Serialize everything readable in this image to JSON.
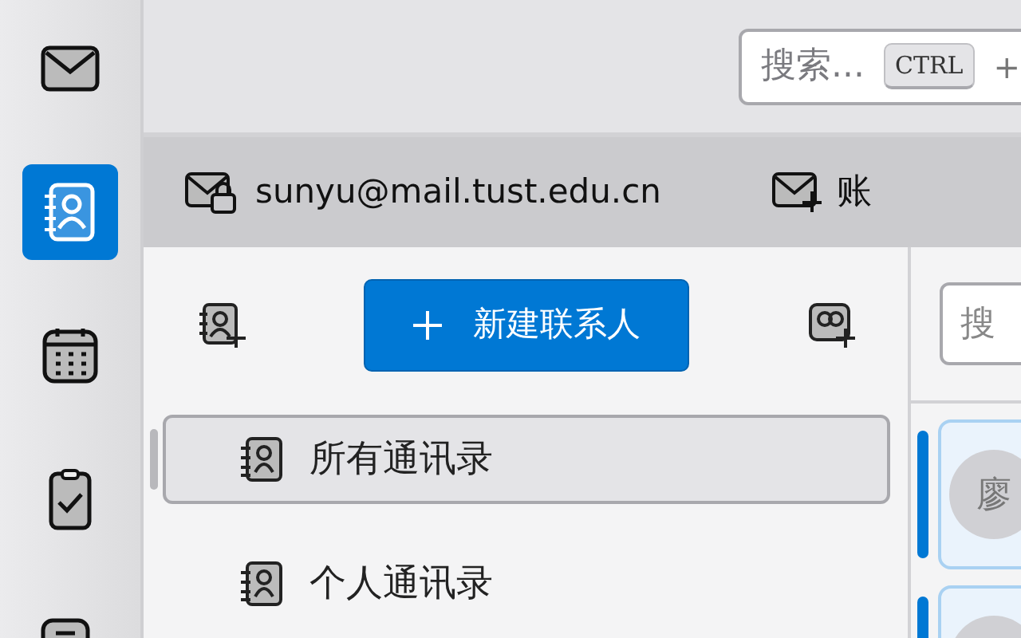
{
  "rail": [
    {
      "kind": "mail",
      "selected": false
    },
    {
      "kind": "contacts",
      "selected": true
    },
    {
      "kind": "calendar",
      "selected": false
    },
    {
      "kind": "tasks",
      "selected": false
    },
    {
      "kind": "chat",
      "selected": false
    }
  ],
  "search": {
    "placeholder": "搜索...",
    "key": "CTRL",
    "plus": "+"
  },
  "account_bar": {
    "address": "sunyu@mail.tust.edu.cn",
    "new_account": "账"
  },
  "toolbar": {
    "new_contact": "新建联系人"
  },
  "address_books": [
    {
      "label": "所有通讯录",
      "selected": true
    },
    {
      "label": "个人通讯录",
      "selected": false
    }
  ],
  "contact_search": {
    "placeholder": "搜"
  },
  "contacts": [
    {
      "kind": "initial",
      "initial": "廖"
    },
    {
      "kind": "blank"
    }
  ]
}
